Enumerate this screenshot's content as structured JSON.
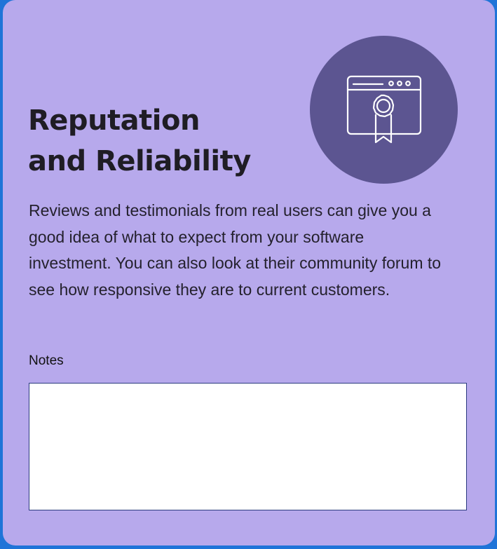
{
  "card": {
    "title_line1": "Reputation",
    "title_line2": "and Reliability",
    "description": "Reviews and testimonials from real users can give you a good idea of what to expect from your software investment. You can also look at their community forum to see how responsive they are to current customers.",
    "icon": "certificate-icon"
  },
  "notes": {
    "label": "Notes",
    "value": ""
  },
  "colors": {
    "background": "#1f74d8",
    "card": "#b7a9ec",
    "icon_circle": "#5c5591",
    "text": "#1f1d24",
    "input_border": "#2b3b7f"
  }
}
